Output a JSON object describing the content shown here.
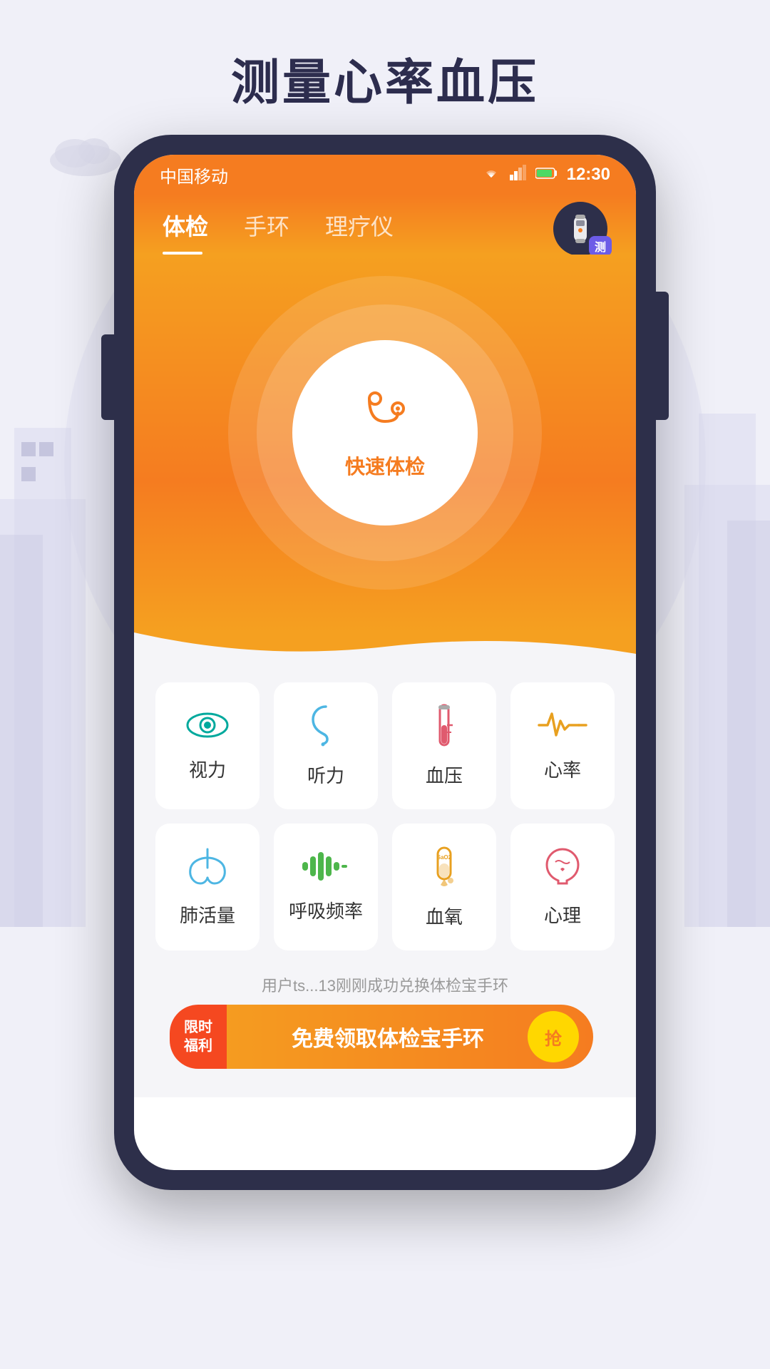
{
  "page": {
    "title": "测量心率血压",
    "background_color": "#f0f0f8"
  },
  "status_bar": {
    "carrier": "中国移动",
    "time": "12:30",
    "wifi_icon": "wifi",
    "signal_icon": "signal",
    "battery_icon": "battery"
  },
  "tabs": [
    {
      "id": "tijian",
      "label": "体检",
      "active": true
    },
    {
      "id": "shuhuan",
      "label": "手环",
      "active": false
    },
    {
      "id": "liaoyi",
      "label": "理疗仪",
      "active": false
    }
  ],
  "wristband_btn": {
    "badge": "测"
  },
  "quick_check": {
    "icon": "🩺",
    "label": "快速体检"
  },
  "grid_items": [
    {
      "id": "vision",
      "icon_color": "#00a99d",
      "label": "视力",
      "icon_type": "eye"
    },
    {
      "id": "hearing",
      "icon_color": "#4db6e3",
      "label": "听力",
      "icon_type": "ear"
    },
    {
      "id": "blood_pressure",
      "icon_color": "#e05a6e",
      "label": "血压",
      "icon_type": "thermometer"
    },
    {
      "id": "heart_rate",
      "icon_color": "#e8a020",
      "label": "心率",
      "icon_type": "heartbeat"
    },
    {
      "id": "lung",
      "icon_color": "#4db6e3",
      "label": "肺活量",
      "icon_type": "lung"
    },
    {
      "id": "breath",
      "icon_color": "#4db64b",
      "label": "呼吸频率",
      "icon_type": "breath"
    },
    {
      "id": "blood_oxygen",
      "icon_color": "#e8a020",
      "label": "血氧",
      "icon_type": "blood_oxygen"
    },
    {
      "id": "mental",
      "icon_color": "#e05a6e",
      "label": "心理",
      "icon_type": "mental"
    }
  ],
  "notification": {
    "text": "用户ts...13刚刚成功兑换体检宝手环"
  },
  "promo_banner": {
    "tag_line1": "限时",
    "tag_line2": "福利",
    "text": "免费领取体检宝手环",
    "btn_text": "抢"
  }
}
